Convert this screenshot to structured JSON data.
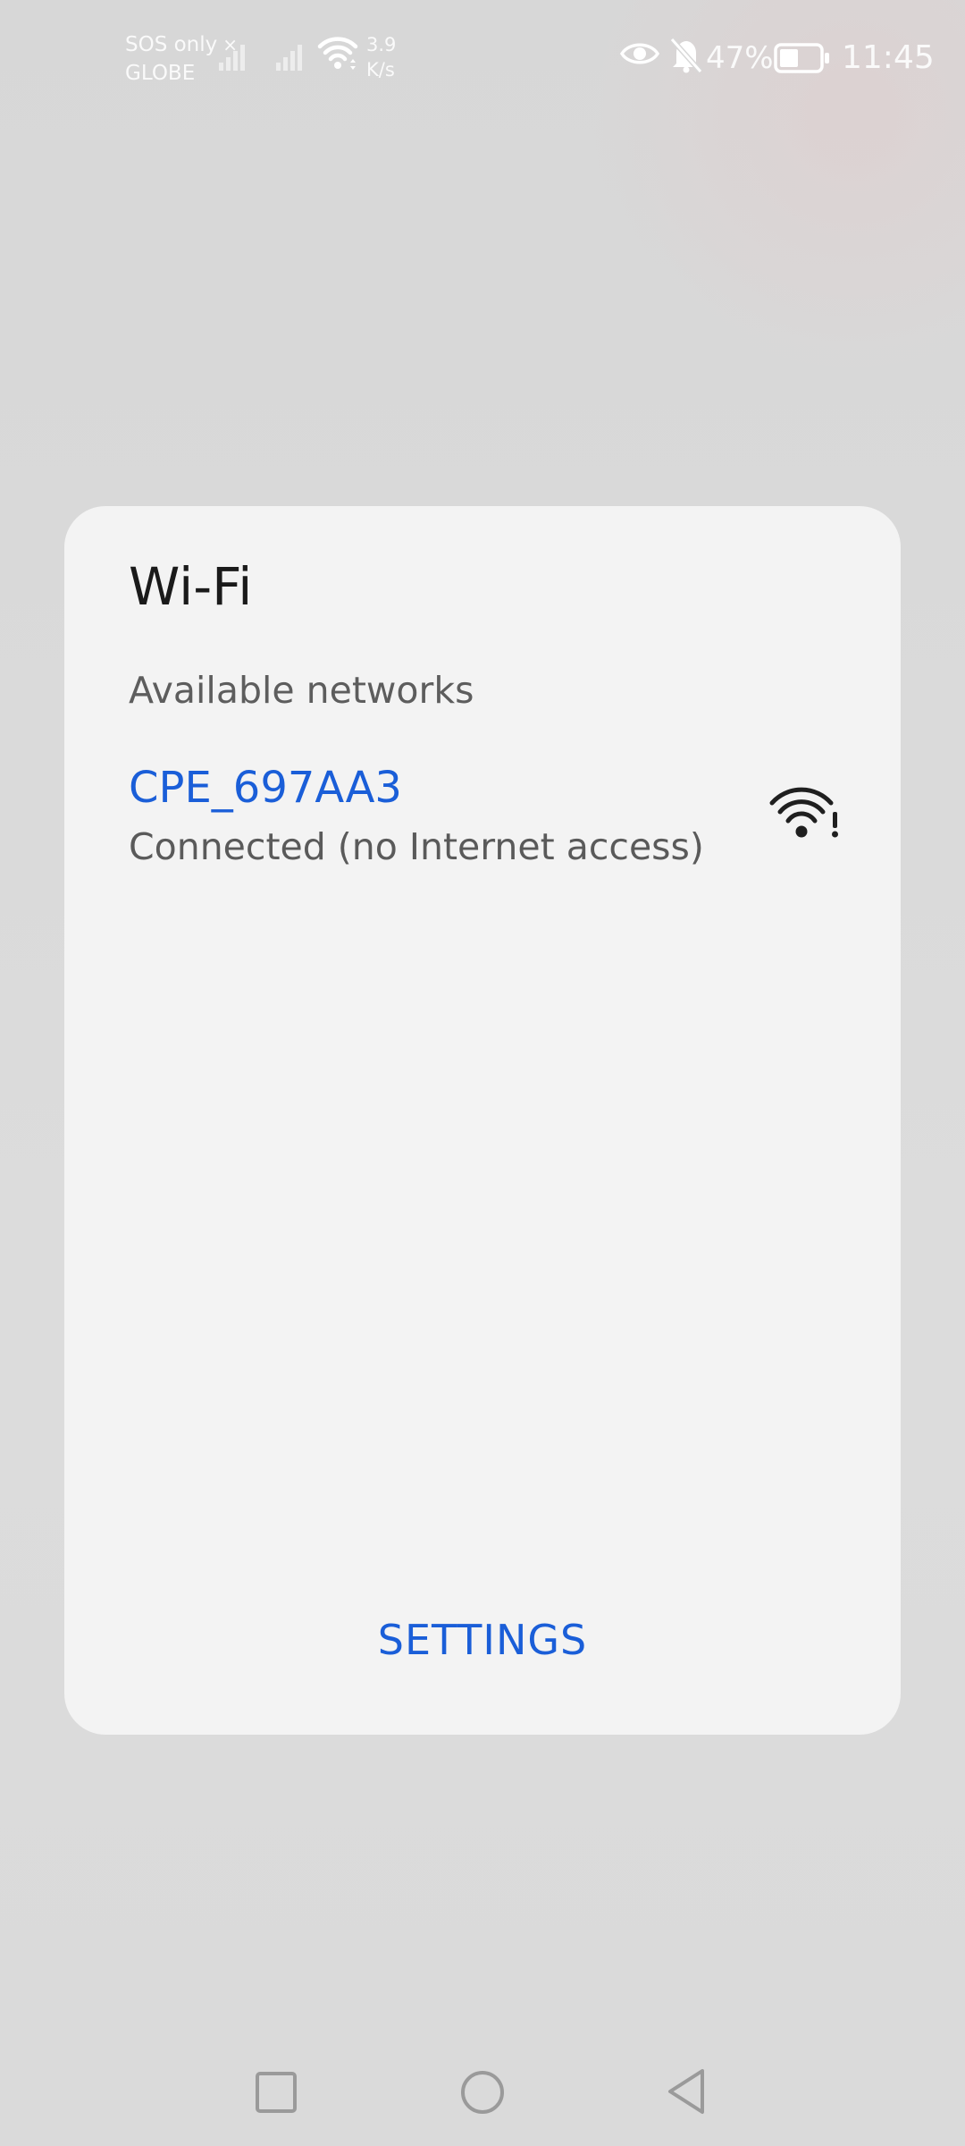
{
  "status_bar": {
    "carrier_line1": "SOS only",
    "carrier_line2": "GLOBE",
    "carrier_x": "×",
    "speed_value": "3.9",
    "speed_unit": "K/s",
    "battery_percent": "47%",
    "battery_level": 0.47,
    "time": "11:45",
    "icons": [
      "signal-bars-icon",
      "signal-bars-icon",
      "wifi-icon",
      "eye-icon",
      "bell-muted-icon",
      "battery-icon"
    ]
  },
  "dialog": {
    "title": "Wi-Fi",
    "section_label": "Available networks",
    "networks": [
      {
        "name": "CPE_697AA3",
        "status": "Connected (no Internet access)",
        "icon": "wifi-warning-icon"
      }
    ],
    "settings_label": "SETTINGS"
  },
  "nav_bar": {
    "icons": [
      "recent-apps-icon",
      "home-icon",
      "back-icon"
    ]
  },
  "colors": {
    "accent": "#1a5ed8",
    "dialog_bg": "#f3f3f3",
    "screen_bg": "#d9d9d9"
  }
}
